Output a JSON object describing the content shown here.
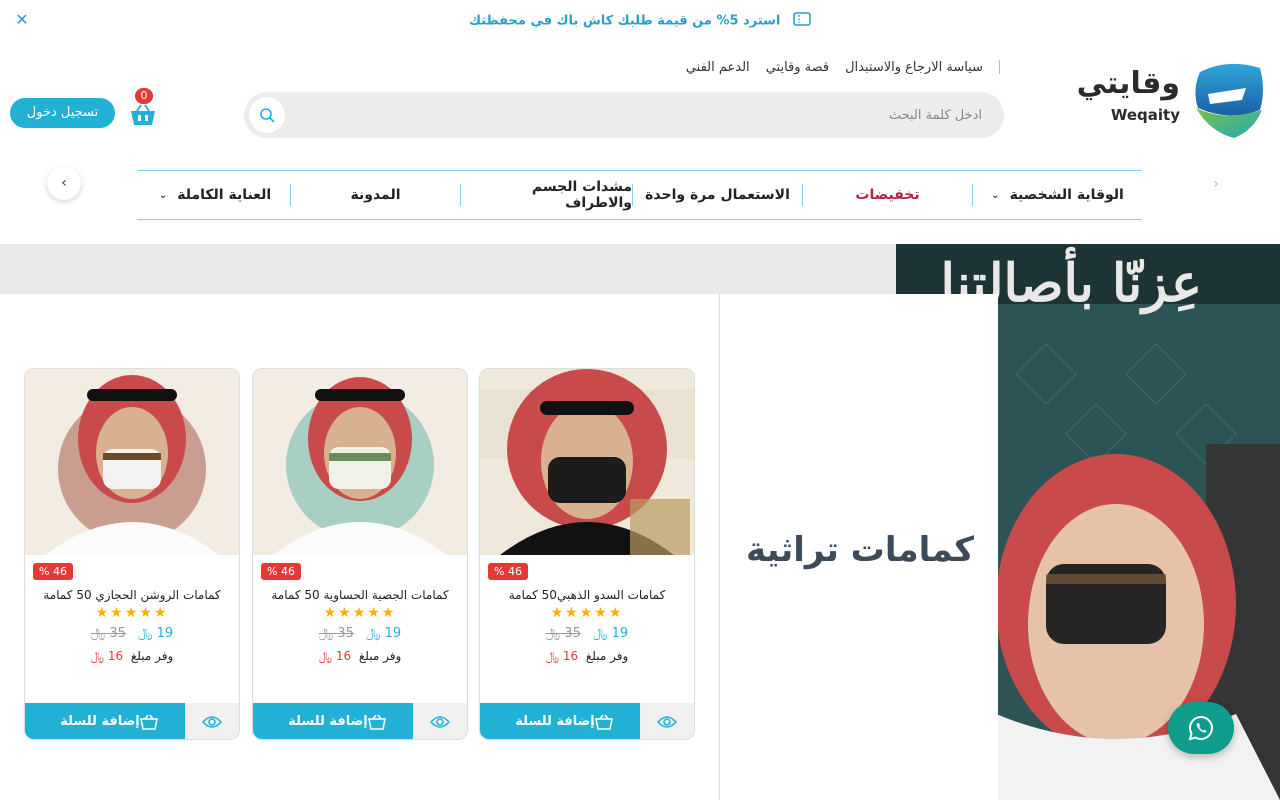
{
  "announcement": {
    "message": "استرد 5% من قيمة طلبك كاش باك في محفظتك",
    "close_icon": "close-icon",
    "ticket_icon": "ticket-icon"
  },
  "top_links": [
    "سياسة الارجاع والاستبدال",
    "قصة وقايتي",
    "الدعم الفني"
  ],
  "logo": {
    "arabic": "وقايتي",
    "english": "Weqaity"
  },
  "search": {
    "placeholder": "ادخل كلمة البحث",
    "icon": "search-icon"
  },
  "cart": {
    "count": "0",
    "icon": "basket-icon"
  },
  "login": {
    "label": "تسجيل دخول"
  },
  "nav": {
    "items": [
      {
        "label": "الوقاية الشخصية",
        "has_dropdown": true
      },
      {
        "label": "تخفيضات",
        "sale": true
      },
      {
        "label": "الاستعمال مرة واحدة"
      },
      {
        "label": "مشدات الجسم والاطراف"
      },
      {
        "label": "المدونة"
      },
      {
        "label": "العناية الكاملة",
        "has_dropdown": true
      }
    ],
    "prev_icon": "chevron-right-icon",
    "next_icon": "chevron-left-icon"
  },
  "hero": {
    "slogan": "عِزنّا بأصالتنا"
  },
  "promo": {
    "title": "كمامات تراثية"
  },
  "colors": {
    "accent": "#22b0d5",
    "sale": "#b3243c",
    "discount": "#e53935",
    "star": "#f5b000",
    "whatsapp": "#0f9c8c"
  },
  "products": [
    {
      "name": "كمامات السدو الذهبي50 كمامة",
      "discount": "46 %",
      "rating": "★★★★★",
      "price": "19",
      "old_price": "35",
      "currency": "﷼",
      "save_label": "وفر مبلغ",
      "save_amount": "16",
      "add_label": "إضافة للسلة"
    },
    {
      "name": "كمامات الجصية الحساوية 50 كمامة",
      "discount": "46 %",
      "rating": "★★★★★",
      "price": "19",
      "old_price": "35",
      "currency": "﷼",
      "save_label": "وفر مبلغ",
      "save_amount": "16",
      "add_label": "إضافة للسلة"
    },
    {
      "name": "كمامات الروشن الحجازي 50 كمامة",
      "discount": "46 %",
      "rating": "★★★★★",
      "price": "19",
      "old_price": "35",
      "currency": "﷼",
      "save_label": "وفر مبلغ",
      "save_amount": "16",
      "add_label": "إضافة للسلة"
    }
  ],
  "whatsapp": {
    "icon": "whatsapp-icon"
  }
}
